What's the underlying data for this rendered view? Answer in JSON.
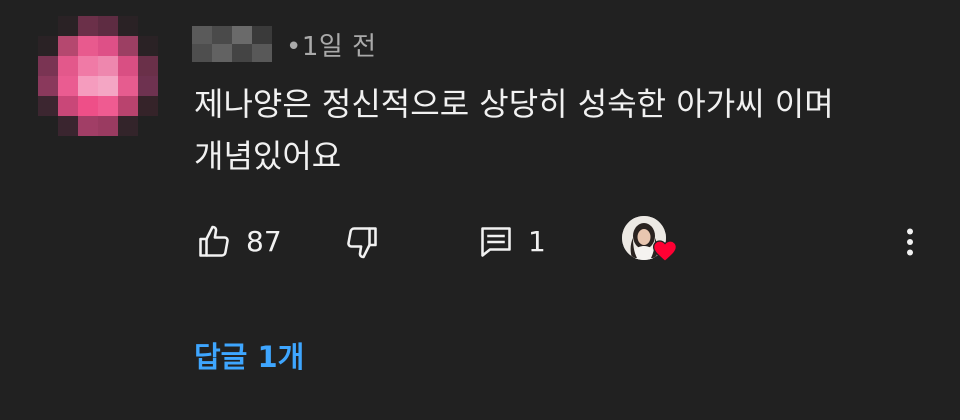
{
  "comment": {
    "time_ago": "1일 전",
    "meta_separator": "•",
    "text_line1": "제나양은 정신적으로 상당히 성숙한 아가씨 이며",
    "text_line2": "개념있어요"
  },
  "actions": {
    "like_icon": "thumbs-up-icon",
    "like_count": "87",
    "dislike_icon": "thumbs-down-icon",
    "reply_icon": "reply-comment-icon",
    "reply_count": "1",
    "creator_heart_icon": "creator-heart-icon",
    "more_icon": "more-vert-icon"
  },
  "replies": {
    "label": "답글 1개"
  },
  "colors": {
    "background": "#212121",
    "text": "#f1f1f1",
    "meta": "#aaaaaa",
    "link": "#3ea6ff",
    "heart": "#ff0033"
  }
}
